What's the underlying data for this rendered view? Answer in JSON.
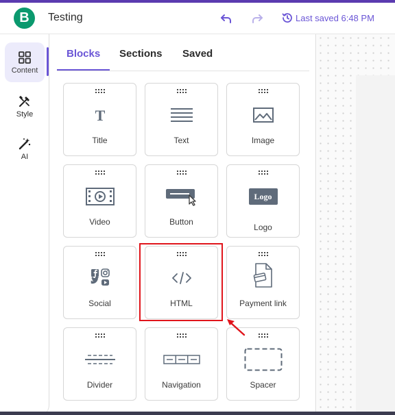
{
  "app": {
    "logo_letter": "B",
    "title": "Testing",
    "save_status": "Last saved 6:48 PM"
  },
  "colors": {
    "accent": "#6a55d6",
    "brand": "#0b996e",
    "highlight": "#e0141b"
  },
  "rail": {
    "items": [
      {
        "label": "Content",
        "icon": "grid-icon",
        "active": true
      },
      {
        "label": "Style",
        "icon": "brush-icon",
        "active": false
      },
      {
        "label": "AI",
        "icon": "magic-wand-icon",
        "active": false
      }
    ]
  },
  "tabs": [
    {
      "label": "Blocks",
      "active": true
    },
    {
      "label": "Sections",
      "active": false
    },
    {
      "label": "Saved",
      "active": false
    }
  ],
  "blocks": [
    {
      "label": "Title",
      "icon": "title-icon"
    },
    {
      "label": "Text",
      "icon": "text-icon"
    },
    {
      "label": "Image",
      "icon": "image-icon"
    },
    {
      "label": "Video",
      "icon": "video-icon"
    },
    {
      "label": "Button",
      "icon": "button-icon"
    },
    {
      "label": "Logo",
      "icon": "logo-icon",
      "icon_text": "Logo"
    },
    {
      "label": "Social",
      "icon": "social-icon"
    },
    {
      "label": "HTML",
      "icon": "code-icon",
      "highlighted": true
    },
    {
      "label": "Payment link",
      "icon": "payment-link-icon"
    },
    {
      "label": "Divider",
      "icon": "divider-icon"
    },
    {
      "label": "Navigation",
      "icon": "navigation-icon"
    },
    {
      "label": "Spacer",
      "icon": "spacer-icon"
    }
  ]
}
